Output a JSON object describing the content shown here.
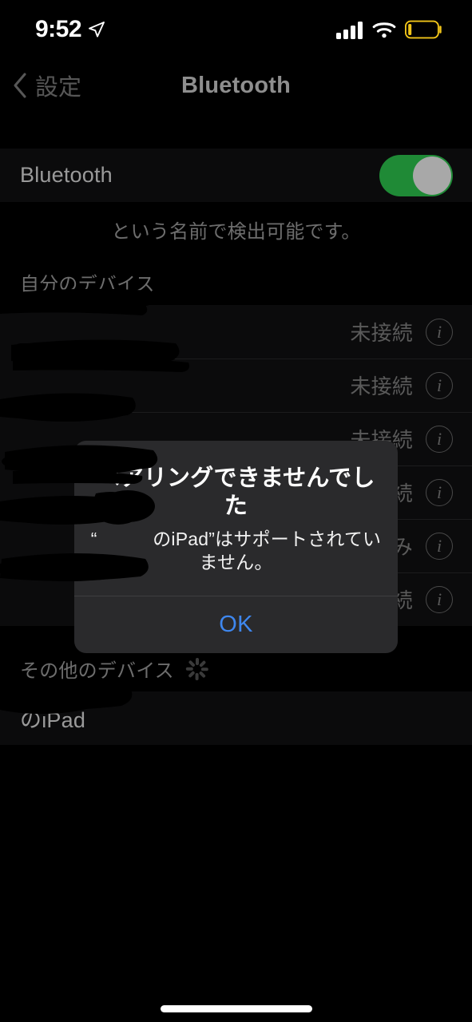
{
  "status_bar": {
    "time": "9:52",
    "location_icon": "location-arrow-icon",
    "cellular_icon": "cellular-bars-icon",
    "wifi_icon": "wifi-icon",
    "battery_icon": "battery-low-power-icon",
    "battery_color": "#F0C419",
    "battery_level_percent": 10
  },
  "nav_bar": {
    "back_label": "設定",
    "back_icon": "chevron-left-icon",
    "title": "Bluetooth"
  },
  "bluetooth_toggle": {
    "label": "Bluetooth",
    "state": "on",
    "on_color": "#1F8A36",
    "knob_color": "#A8A8A8"
  },
  "discoverable_footer": "という名前で検出可能です。",
  "my_devices": {
    "header": "自分のデバイス",
    "rows": [
      {
        "name": "",
        "status": "未接続",
        "info_icon": "info-circle-icon"
      },
      {
        "name": "",
        "status": "未接続",
        "info_icon": "info-circle-icon"
      },
      {
        "name": "",
        "status": "未接続",
        "info_icon": "info-circle-icon"
      },
      {
        "name": "",
        "status": "未接続",
        "info_icon": "info-circle-icon"
      },
      {
        "name": "",
        "status": "接続済み",
        "info_icon": "info-circle-icon"
      },
      {
        "name": "",
        "status": "未接続",
        "info_icon": "info-circle-icon"
      }
    ]
  },
  "other_devices": {
    "header": "その他のデバイス",
    "spinner_icon": "activity-spinner-icon",
    "rows": [
      {
        "name": "のiPad"
      }
    ]
  },
  "alert": {
    "title": "ペアリングできませんでした",
    "message": "“　　　のiPad”はサポートされていません。",
    "ok_label": "OK",
    "ok_color": "#3E87EF",
    "background_color": "#2A2A2C"
  },
  "home_indicator": "home-indicator"
}
